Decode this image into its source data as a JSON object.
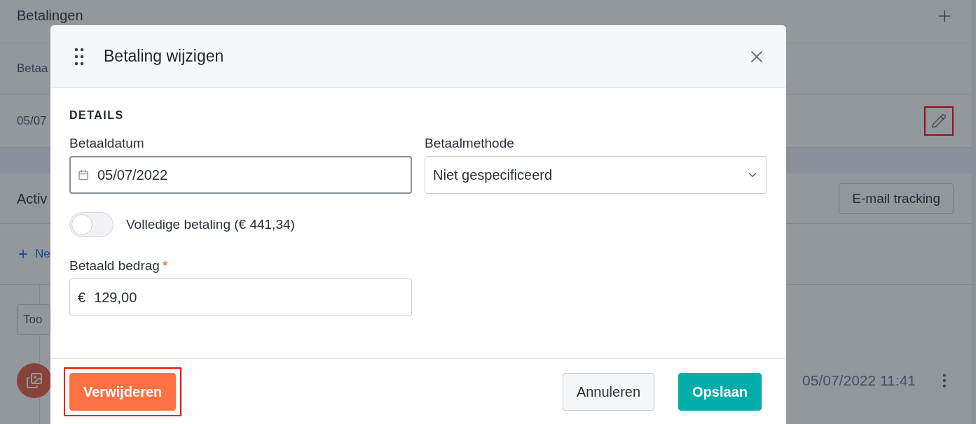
{
  "background": {
    "payments_title": "Betalingen",
    "column_header": "Betaa",
    "payment_row": {
      "date": "05/07",
      "edit_highlighted": true
    },
    "activity_title": "Activ",
    "email_tracking_button": "E-mail tracking",
    "new_link": "Ne",
    "filter_dropdown": "Too",
    "activity_entry": {
      "timestamp": "05/07/2022 11:41"
    }
  },
  "dialog": {
    "title": "Betaling wijzigen",
    "section": "DETAILS",
    "date_field": {
      "label": "Betaaldatum",
      "value": "05/07/2022",
      "focused": true
    },
    "method_field": {
      "label": "Betaalmethode",
      "value": "Niet gespecificeerd"
    },
    "full_payment_toggle": {
      "label": "Volledige betaling (€ 441,34)",
      "on": false
    },
    "amount_field": {
      "label": "Betaald bedrag",
      "required_mark": "*",
      "currency": "€",
      "value": "129,00"
    },
    "buttons": [
      {
        "kind": "danger",
        "label": "Verwijderen",
        "highlighted": true
      },
      {
        "kind": "secondary",
        "label": "Annuleren",
        "highlighted": false
      },
      {
        "kind": "primary",
        "label": "Opslaan",
        "highlighted": false
      }
    ]
  }
}
